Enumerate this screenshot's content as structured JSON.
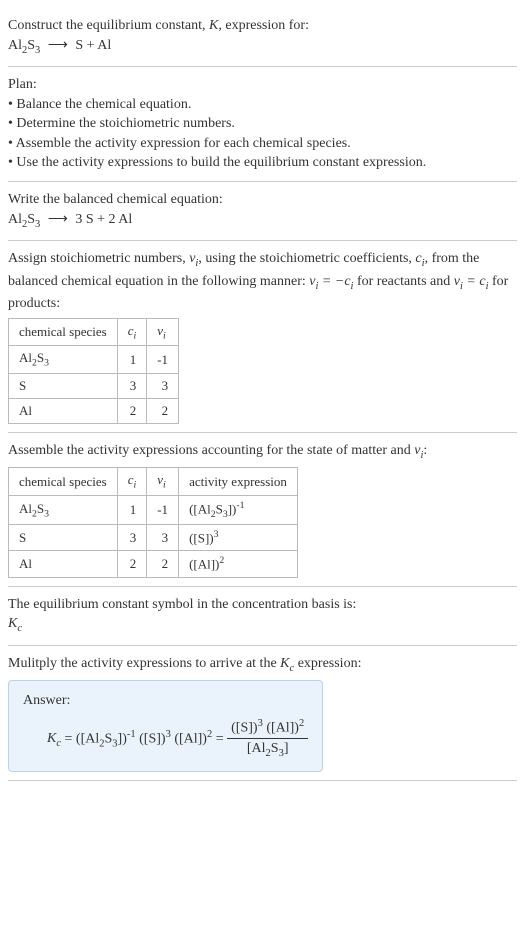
{
  "intro": {
    "line1_pre": "Construct the equilibrium constant, ",
    "line1_post": ", expression for:"
  },
  "plan": {
    "heading": "Plan:",
    "b1": "• Balance the chemical equation.",
    "b2": "• Determine the stoichiometric numbers.",
    "b3": "• Assemble the activity expression for each chemical species.",
    "b4": "• Use the activity expressions to build the equilibrium constant expression."
  },
  "balanced": {
    "heading": "Write the balanced chemical equation:"
  },
  "stoich": {
    "text_pre": "Assign stoichiometric numbers, ",
    "text_mid1": ", using the stoichiometric coefficients, ",
    "text_mid2": ", from the balanced chemical equation in the following manner: ",
    "text_mid3": " for reactants and ",
    "text_post": " for products:",
    "headers": {
      "species": "chemical species"
    },
    "rows": [
      {
        "ci": "1",
        "vi": "-1"
      },
      {
        "ci": "3",
        "vi": "3"
      },
      {
        "ci": "2",
        "vi": "2"
      }
    ]
  },
  "activity": {
    "text_pre": "Assemble the activity expressions accounting for the state of matter and ",
    "text_post": ":",
    "headers": {
      "species": "chemical species",
      "activity": "activity expression"
    },
    "rows": [
      {
        "ci": "1",
        "vi": "-1"
      },
      {
        "ci": "3",
        "vi": "3"
      },
      {
        "ci": "2",
        "vi": "2"
      }
    ]
  },
  "symbol": {
    "text": "The equilibrium constant symbol in the concentration basis is:"
  },
  "multiply": {
    "text_pre": "Mulitply the activity expressions to arrive at the ",
    "text_post": " expression:"
  },
  "answer": {
    "label": "Answer:"
  }
}
